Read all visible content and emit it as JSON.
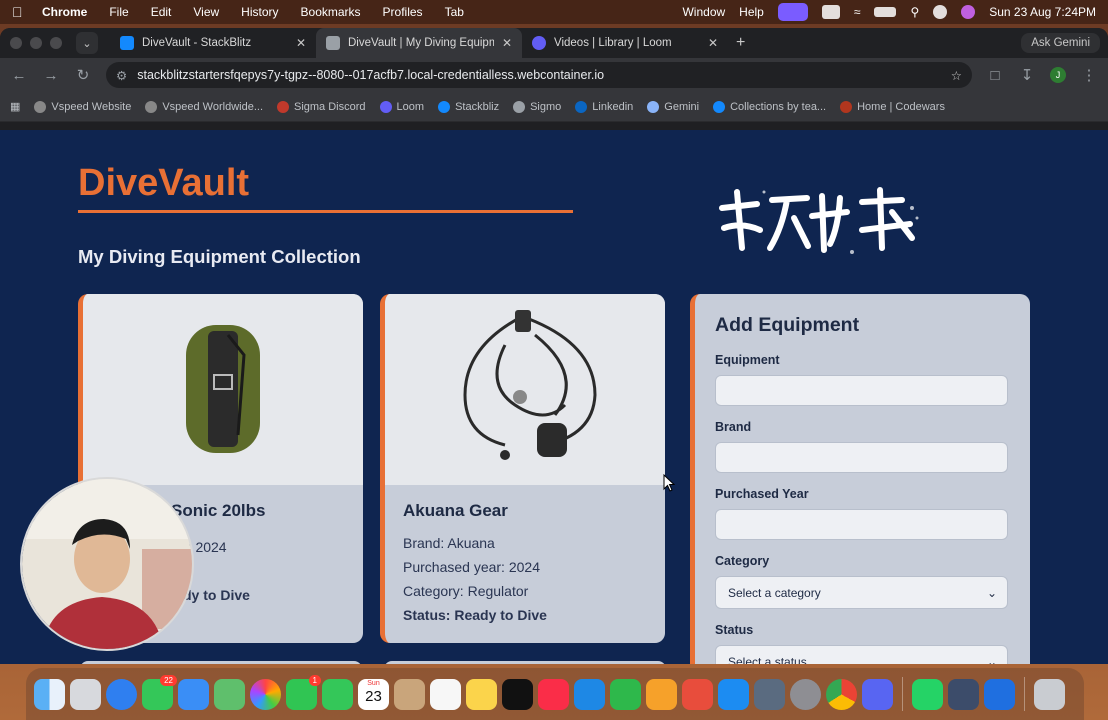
{
  "menubar": {
    "app": "Chrome",
    "menus": [
      "File",
      "Edit",
      "View",
      "History",
      "Bookmarks",
      "Profiles",
      "Tab"
    ],
    "window_menu": "Window",
    "help_menu": "Help",
    "datetime": "Sun 23 Aug  7:24PM"
  },
  "tabs": [
    {
      "title": "DiveVault - StackBlitz",
      "icon": "stackblitz-icon"
    },
    {
      "title": "DiveVault | My Diving Equipm",
      "icon": "page-icon"
    },
    {
      "title": "Videos | Library | Loom",
      "icon": "loom-icon"
    }
  ],
  "ask_gemini": "Ask Gemini",
  "address": "stackblitzstartersfqepys7y-tgpz--8080--017acfb7.local-credentialless.webcontainer.io",
  "profile_initial": "J",
  "bookmarks": [
    {
      "label": "Vspeed Website",
      "color": "#888888"
    },
    {
      "label": "Vspeed Worldwide...",
      "color": "#888888"
    },
    {
      "label": "Sigma Discord",
      "color": "#c0392b"
    },
    {
      "label": "Loom",
      "color": "#625df5"
    },
    {
      "label": "Stackbliz",
      "color": "#1389fd"
    },
    {
      "label": "Sigmo",
      "color": "#9aa0a6"
    },
    {
      "label": "Linkedin",
      "color": "#0a66c2"
    },
    {
      "label": "Gemini",
      "color": "#8ab4f8"
    },
    {
      "label": "Collections by tea...",
      "color": "#1389fd"
    },
    {
      "label": "Home | Codewars",
      "color": "#b1361e"
    }
  ],
  "page": {
    "brand": "DiveVault",
    "collection_title": "My Diving Equipment Collection",
    "accent": "#e87035",
    "background": "#0f2550"
  },
  "cards": [
    {
      "name": "Sonic 20lbs",
      "lines": [
        "r: 2024",
        "o"
      ],
      "status": "dy to Dive",
      "image": "bcd-wing-image"
    },
    {
      "name": "Akuana Gear",
      "lines": [
        "Brand: Akuana",
        "Purchased year: 2024",
        "Category: Regulator"
      ],
      "status": "Status: Ready to Dive",
      "image": "regulator-image"
    }
  ],
  "form": {
    "title": "Add Equipment",
    "equipment_label": "Equipment",
    "brand_label": "Brand",
    "year_label": "Purchased Year",
    "category_label": "Category",
    "category_placeholder": "Select a category",
    "status_label": "Status",
    "status_placeholder": "Select a status"
  },
  "dock": {
    "messages_badge": "22",
    "facetime_badge": "1",
    "calendar_day": "23",
    "calendar_month": "Sun"
  }
}
